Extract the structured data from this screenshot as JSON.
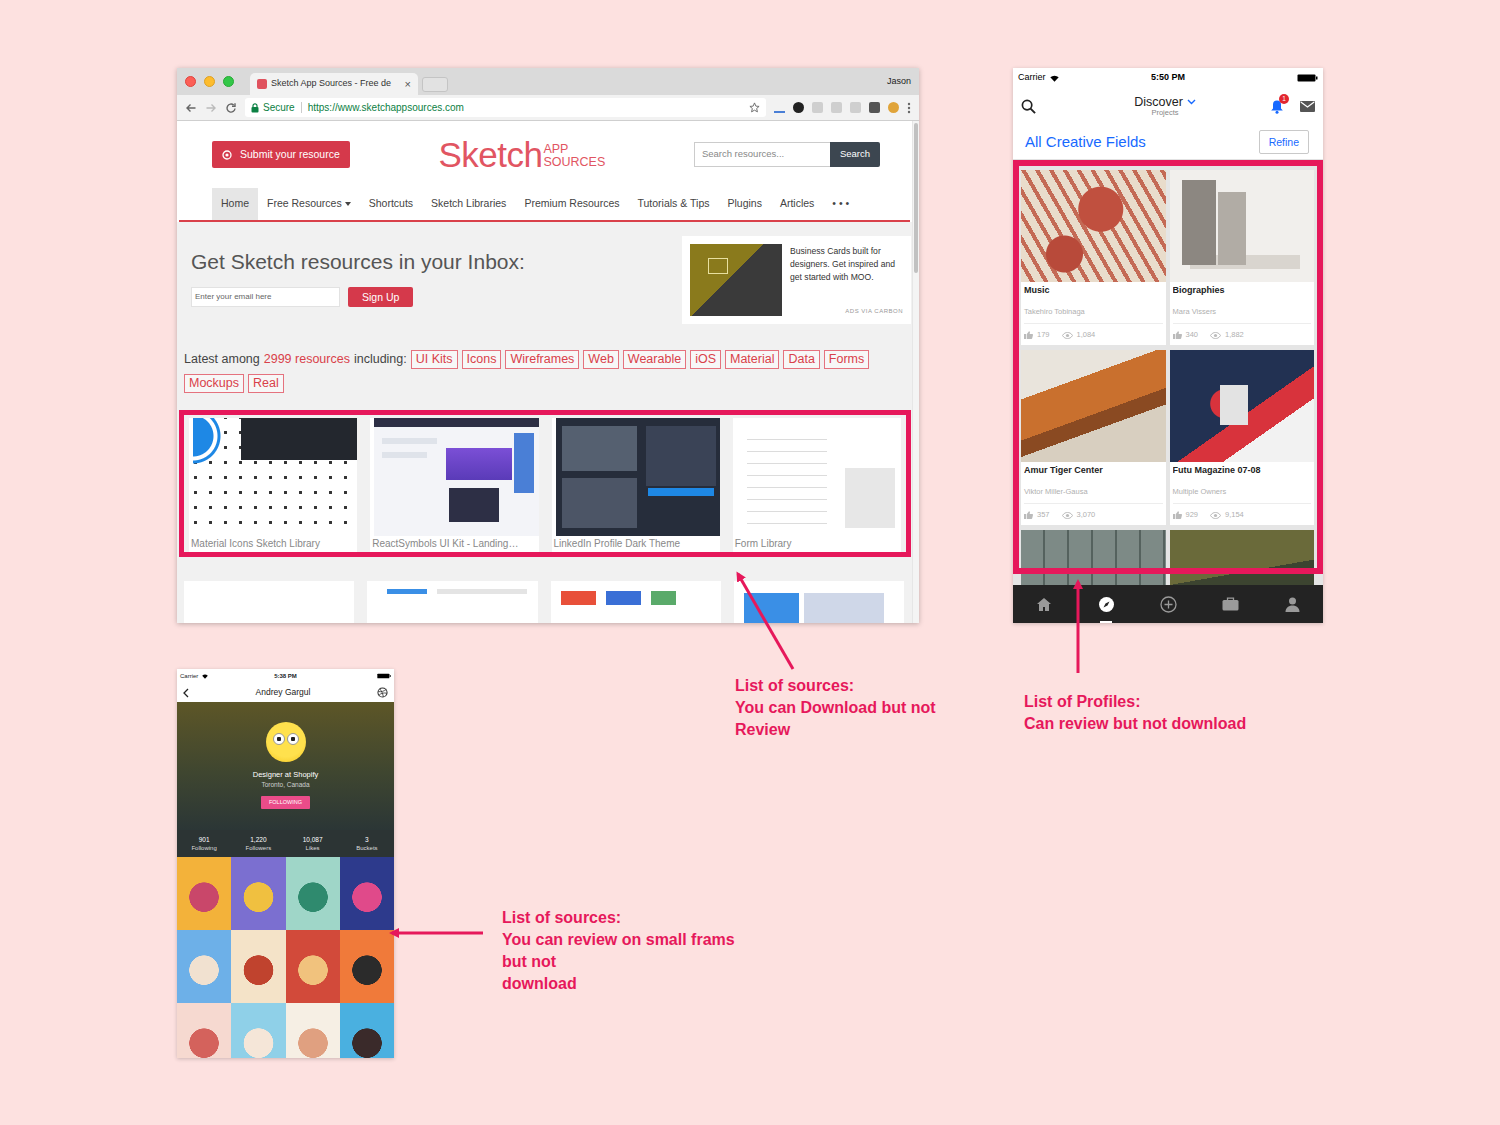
{
  "browser": {
    "tab": {
      "title": "Sketch App Sources - Free de",
      "close": "×"
    },
    "user": "Jason",
    "address": {
      "secure": "Secure",
      "url": "https://www.sketchappsources.com"
    },
    "submit": "Submit your resource",
    "logo": {
      "main": "Sketch",
      "top": "APP",
      "bottom": "SOURCES"
    },
    "search": {
      "placeholder": "Search resources...",
      "button": "Search"
    },
    "nav": [
      {
        "label": "Home",
        "selected": true,
        "dropdown": false
      },
      {
        "label": "Free Resources",
        "selected": false,
        "dropdown": true
      },
      {
        "label": "Shortcuts",
        "selected": false,
        "dropdown": false
      },
      {
        "label": "Sketch Libraries",
        "selected": false,
        "dropdown": false
      },
      {
        "label": "Premium Resources",
        "selected": false,
        "dropdown": false
      },
      {
        "label": "Tutorials & Tips",
        "selected": false,
        "dropdown": false
      },
      {
        "label": "Plugins",
        "selected": false,
        "dropdown": false
      },
      {
        "label": "Articles",
        "selected": false,
        "dropdown": false
      },
      {
        "label": "• • •",
        "selected": false,
        "dropdown": false
      }
    ],
    "newsletter": {
      "title": "Get Sketch resources in your Inbox:",
      "placeholder": "Enter your email here",
      "button": "Sign Up"
    },
    "ad": {
      "text": "Business Cards built for designers. Get inspired and get started with MOO.",
      "credit": "ADS VIA CARBON"
    },
    "latest": {
      "prefix": "Latest among",
      "count": "2999 resources",
      "suffix": "including:",
      "tags": [
        "UI Kits",
        "Icons",
        "Wireframes",
        "Web",
        "Wearable",
        "iOS",
        "Material",
        "Data",
        "Forms",
        "Mockups",
        "Real"
      ]
    },
    "resources": [
      {
        "title": "Material Icons Sketch Library"
      },
      {
        "title": "ReactSymbols UI Kit - Landing…"
      },
      {
        "title": "LinkedIn Profile Dark Theme"
      },
      {
        "title": "Form Library"
      }
    ]
  },
  "discover": {
    "carrier": "Carrier",
    "time": "5:50 PM",
    "title": "Discover",
    "subtitle": "Projects",
    "badge": "1",
    "filter": "All Creative Fields",
    "refine": "Refine",
    "projects": [
      {
        "title": "Music",
        "owner": "Takehiro Tobinaga",
        "likes": "179",
        "views": "1,084"
      },
      {
        "title": "Biographies",
        "owner": "Mara Vissers",
        "likes": "340",
        "views": "1,882"
      },
      {
        "title": "Amur Tiger Center",
        "owner": "Viktor Miller-Gausa",
        "likes": "357",
        "views": "3,070"
      },
      {
        "title": "Futu Magazine 07-08",
        "owner": "Multiple Owners",
        "likes": "929",
        "views": "9,154"
      }
    ],
    "tabs": [
      {
        "selected": false
      },
      {
        "selected": true
      },
      {
        "selected": false
      },
      {
        "selected": false
      },
      {
        "selected": false
      }
    ]
  },
  "profile": {
    "carrier": "Carrier",
    "time": "5:38 PM",
    "name": "Andrey Gargul",
    "role": "Designer at Shopify",
    "location": "Toronto, Canada",
    "follow": "FOLLOWING",
    "stats": [
      {
        "value": "901",
        "label": "Following"
      },
      {
        "value": "1,220",
        "label": "Followers"
      },
      {
        "value": "10,087",
        "label": "Likes"
      },
      {
        "value": "3",
        "label": "Buckets"
      }
    ]
  },
  "annotations": [
    {
      "lines": [
        "List of sources:",
        "You can Download but not",
        "Review"
      ]
    },
    {
      "lines": [
        "List of Profiles:",
        "Can review but not download"
      ]
    },
    {
      "lines": [
        "List of sources:",
        "You can review on small frams",
        "but not",
        "download"
      ]
    }
  ]
}
